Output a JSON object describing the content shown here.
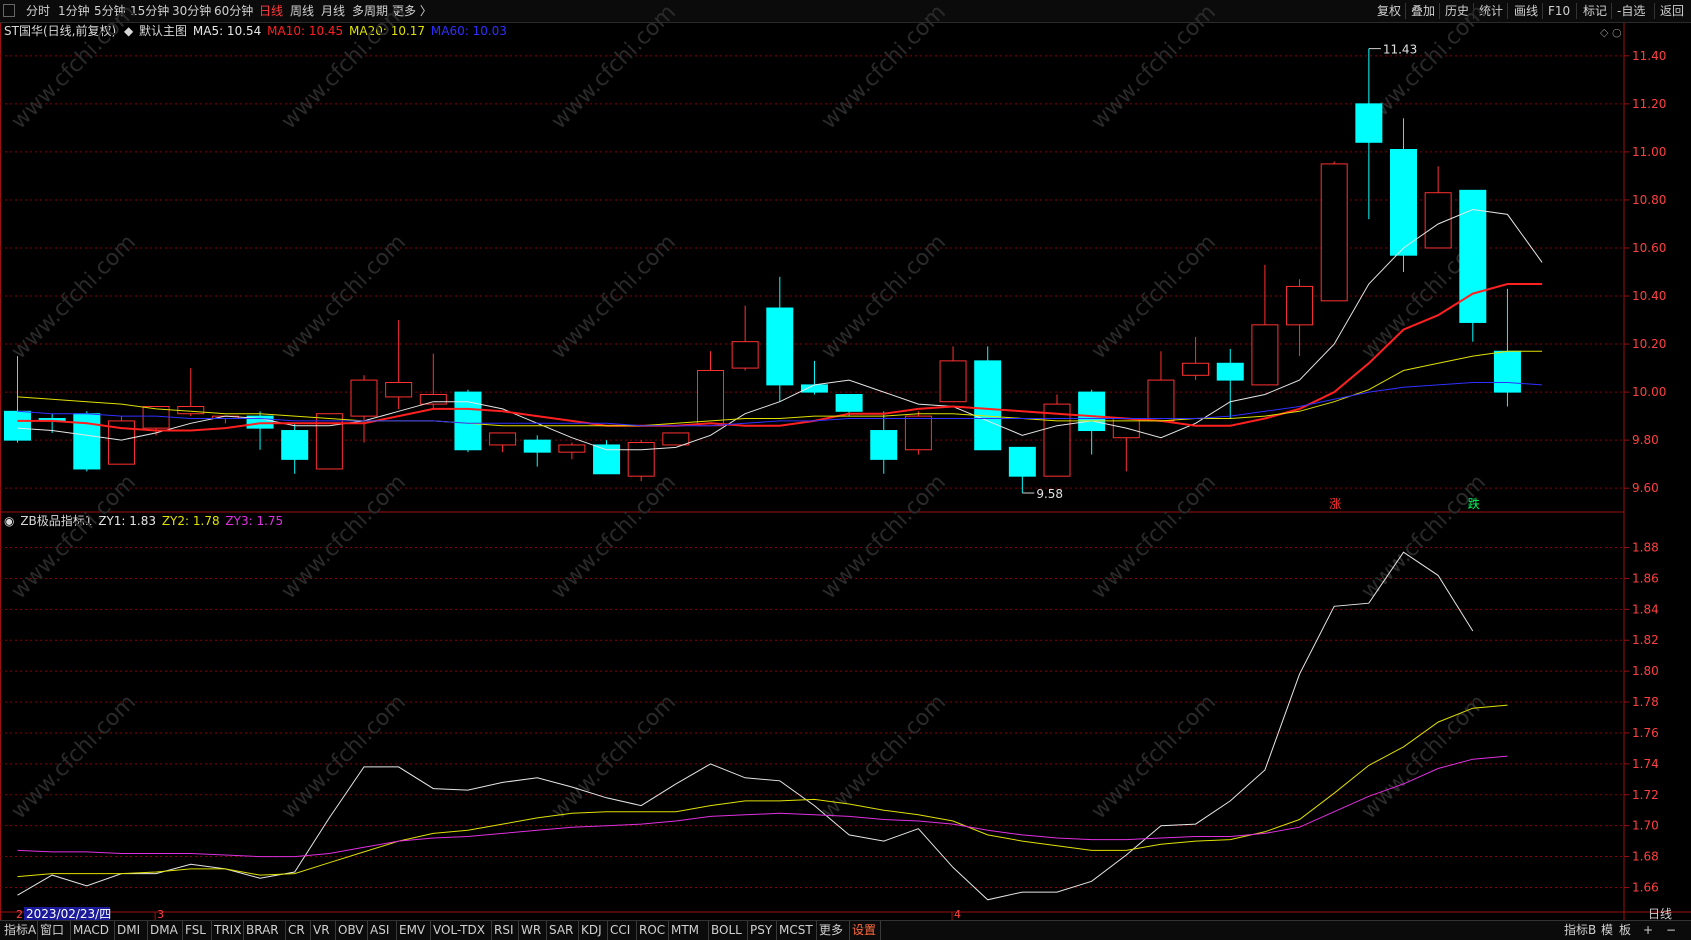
{
  "toolbar": {
    "periods": [
      "分时",
      "1分钟",
      "5分钟",
      "15分钟",
      "30分钟",
      "60分钟",
      "日线",
      "周线",
      "月线",
      "多周期",
      "更多 〉"
    ],
    "active_period": "日线",
    "right_items": [
      "复权",
      "叠加",
      "历史",
      "统计",
      "画线",
      "F10",
      "标记",
      "-自选",
      "返回"
    ]
  },
  "main_chart": {
    "title": "ST国华(日线,前复权)",
    "template": "默认主图",
    "indicators": [
      {
        "label": "MA5: 10.54",
        "color": "#e6e6e6"
      },
      {
        "label": "MA10: 10.45",
        "color": "#ff2020"
      },
      {
        "label": "MA20: 10.17",
        "color": "#e0e000"
      },
      {
        "label": "MA60: 10.03",
        "color": "#3030ff"
      }
    ],
    "high_label": "11.43",
    "low_label": "9.58",
    "up_marker": "涨",
    "down_marker": "跌",
    "ylim": [
      9.53,
      11.47
    ],
    "yticks": [
      "11.40",
      "11.20",
      "11.00",
      "10.80",
      "10.60",
      "10.40",
      "10.20",
      "10.00",
      "9.80",
      "9.60"
    ]
  },
  "sub_chart": {
    "title": "ZB极品指标1",
    "indicators": [
      {
        "label": "ZY1: 1.83",
        "color": "#e6e6e6"
      },
      {
        "label": "ZY2: 1.78",
        "color": "#e0e000"
      },
      {
        "label": "ZY3: 1.75",
        "color": "#e030e0"
      }
    ],
    "ylim": [
      1.648,
      1.892
    ],
    "yticks": [
      "1.88",
      "1.86",
      "1.84",
      "1.82",
      "1.80",
      "1.78",
      "1.76",
      "1.74",
      "1.72",
      "1.70",
      "1.68",
      "1.66"
    ]
  },
  "time_axis": {
    "current_date": "2023/02/23/四",
    "month_markers": [
      {
        "label": "3",
        "index": 4
      },
      {
        "label": "4",
        "index": 27
      }
    ]
  },
  "watermark": "www.cfchi.com",
  "chart_data": {
    "type": "candlestick",
    "candles": [
      {
        "o": 9.92,
        "h": 10.15,
        "l": 9.79,
        "c": 9.8
      },
      {
        "o": 9.89,
        "h": 9.91,
        "l": 9.83,
        "c": 9.88
      },
      {
        "o": 9.91,
        "h": 9.92,
        "l": 9.67,
        "c": 9.68
      },
      {
        "o": 9.7,
        "h": 9.9,
        "l": 9.7,
        "c": 9.88
      },
      {
        "o": 9.85,
        "h": 9.94,
        "l": 9.82,
        "c": 9.94
      },
      {
        "o": 9.91,
        "h": 10.1,
        "l": 9.9,
        "c": 9.94
      },
      {
        "o": 9.89,
        "h": 9.9,
        "l": 9.87,
        "c": 9.9
      },
      {
        "o": 9.9,
        "h": 9.92,
        "l": 9.76,
        "c": 9.85
      },
      {
        "o": 9.84,
        "h": 9.87,
        "l": 9.66,
        "c": 9.72
      },
      {
        "o": 9.68,
        "h": 9.91,
        "l": 9.68,
        "c": 9.91
      },
      {
        "o": 9.9,
        "h": 10.07,
        "l": 9.79,
        "c": 10.05
      },
      {
        "o": 9.98,
        "h": 10.3,
        "l": 9.93,
        "c": 10.04
      },
      {
        "o": 9.95,
        "h": 10.16,
        "l": 9.93,
        "c": 9.99
      },
      {
        "o": 10.0,
        "h": 10.01,
        "l": 9.75,
        "c": 9.76
      },
      {
        "o": 9.78,
        "h": 9.82,
        "l": 9.75,
        "c": 9.83
      },
      {
        "o": 9.8,
        "h": 9.82,
        "l": 9.69,
        "c": 9.75
      },
      {
        "o": 9.75,
        "h": 9.79,
        "l": 9.72,
        "c": 9.78
      },
      {
        "o": 9.78,
        "h": 9.8,
        "l": 9.66,
        "c": 9.66
      },
      {
        "o": 9.65,
        "h": 9.8,
        "l": 9.63,
        "c": 9.79
      },
      {
        "o": 9.78,
        "h": 9.83,
        "l": 9.78,
        "c": 9.83
      },
      {
        "o": 9.86,
        "h": 10.17,
        "l": 9.86,
        "c": 10.09
      },
      {
        "o": 10.1,
        "h": 10.36,
        "l": 10.09,
        "c": 10.21
      },
      {
        "o": 10.35,
        "h": 10.48,
        "l": 9.96,
        "c": 10.03
      },
      {
        "o": 10.03,
        "h": 10.13,
        "l": 9.99,
        "c": 10.0
      },
      {
        "o": 9.99,
        "h": 9.99,
        "l": 9.9,
        "c": 9.92
      },
      {
        "o": 9.84,
        "h": 9.92,
        "l": 9.66,
        "c": 9.72
      },
      {
        "o": 9.76,
        "h": 9.92,
        "l": 9.74,
        "c": 9.9
      },
      {
        "o": 9.96,
        "h": 10.19,
        "l": 9.96,
        "c": 10.13
      },
      {
        "o": 10.13,
        "h": 10.19,
        "l": 9.76,
        "c": 9.76
      },
      {
        "o": 9.77,
        "h": 9.77,
        "l": 9.58,
        "c": 9.65
      },
      {
        "o": 9.65,
        "h": 9.99,
        "l": 9.65,
        "c": 9.95
      },
      {
        "o": 10.0,
        "h": 10.01,
        "l": 9.74,
        "c": 9.84
      },
      {
        "o": 9.81,
        "h": 9.89,
        "l": 9.67,
        "c": 9.89
      },
      {
        "o": 9.88,
        "h": 10.17,
        "l": 9.88,
        "c": 10.05
      },
      {
        "o": 10.07,
        "h": 10.23,
        "l": 10.05,
        "c": 10.12
      },
      {
        "o": 10.12,
        "h": 10.18,
        "l": 9.89,
        "c": 10.05
      },
      {
        "o": 10.03,
        "h": 10.53,
        "l": 10.03,
        "c": 10.28
      },
      {
        "o": 10.28,
        "h": 10.47,
        "l": 10.15,
        "c": 10.44
      },
      {
        "o": 10.38,
        "h": 10.96,
        "l": 10.38,
        "c": 10.95
      },
      {
        "o": 11.2,
        "h": 11.43,
        "l": 10.72,
        "c": 11.04
      },
      {
        "o": 11.01,
        "h": 11.14,
        "l": 10.5,
        "c": 10.57
      },
      {
        "o": 10.6,
        "h": 10.94,
        "l": 10.6,
        "c": 10.83
      },
      {
        "o": 10.84,
        "h": 10.84,
        "l": 10.21,
        "c": 10.29
      },
      {
        "o": 10.17,
        "h": 10.43,
        "l": 9.94,
        "c": 10.0
      }
    ],
    "series": [
      {
        "name": "MA5",
        "values": [
          9.85,
          9.84,
          9.82,
          9.8,
          9.83,
          9.87,
          9.9,
          9.89,
          9.86,
          9.86,
          9.88,
          9.92,
          9.96,
          9.96,
          9.93,
          9.87,
          9.81,
          9.76,
          9.76,
          9.77,
          9.82,
          9.91,
          9.96,
          10.03,
          10.05,
          10.0,
          9.95,
          9.94,
          9.88,
          9.82,
          9.86,
          9.88,
          9.85,
          9.81,
          9.87,
          9.96,
          9.99,
          10.05,
          10.2,
          10.45,
          10.6,
          10.7,
          10.76,
          10.74,
          10.54
        ]
      },
      {
        "name": "MA10",
        "values": [
          9.88,
          9.88,
          9.87,
          9.85,
          9.84,
          9.84,
          9.85,
          9.87,
          9.87,
          9.87,
          9.87,
          9.9,
          9.93,
          9.93,
          9.92,
          9.9,
          9.88,
          9.86,
          9.86,
          9.86,
          9.87,
          9.86,
          9.86,
          9.88,
          9.91,
          9.91,
          9.93,
          9.94,
          9.93,
          9.92,
          9.91,
          9.9,
          9.89,
          9.88,
          9.86,
          9.86,
          9.89,
          9.93,
          10.0,
          10.12,
          10.26,
          10.32,
          10.41,
          10.45,
          10.45
        ]
      },
      {
        "name": "MA20",
        "values": [
          9.98,
          9.97,
          9.96,
          9.95,
          9.93,
          9.92,
          9.91,
          9.91,
          9.9,
          9.89,
          9.88,
          9.88,
          9.88,
          9.87,
          9.86,
          9.86,
          9.86,
          9.86,
          9.86,
          9.87,
          9.88,
          9.89,
          9.89,
          9.9,
          9.9,
          9.9,
          9.91,
          9.91,
          9.9,
          9.89,
          9.88,
          9.88,
          9.88,
          9.88,
          9.89,
          9.89,
          9.9,
          9.92,
          9.96,
          10.01,
          10.09,
          10.12,
          10.15,
          10.17,
          10.17
        ]
      },
      {
        "name": "MA60",
        "values": [
          9.92,
          9.91,
          9.91,
          9.9,
          9.9,
          9.89,
          9.89,
          9.89,
          9.88,
          9.88,
          9.88,
          9.88,
          9.88,
          9.87,
          9.87,
          9.87,
          9.87,
          9.87,
          9.86,
          9.86,
          9.86,
          9.87,
          9.88,
          9.88,
          9.89,
          9.89,
          9.89,
          9.89,
          9.89,
          9.89,
          9.89,
          9.89,
          9.89,
          9.89,
          9.89,
          9.9,
          9.92,
          9.94,
          9.97,
          10.0,
          10.02,
          10.03,
          10.04,
          10.04,
          10.03
        ]
      },
      {
        "name": "ZY1",
        "values": [
          1.655,
          1.668,
          1.661,
          1.669,
          1.669,
          1.675,
          1.672,
          1.666,
          1.67,
          1.705,
          1.738,
          1.738,
          1.724,
          1.723,
          1.728,
          1.731,
          1.725,
          1.718,
          1.713,
          1.727,
          1.74,
          1.731,
          1.729,
          1.713,
          1.694,
          1.69,
          1.698,
          1.673,
          1.652,
          1.657,
          1.657,
          1.664,
          1.681,
          1.7,
          1.701,
          1.716,
          1.736,
          1.798,
          1.842,
          1.844,
          1.877,
          1.862,
          1.826
        ]
      },
      {
        "name": "ZY2",
        "values": [
          1.667,
          1.669,
          1.669,
          1.669,
          1.67,
          1.672,
          1.672,
          1.668,
          1.669,
          1.676,
          1.683,
          1.69,
          1.695,
          1.697,
          1.701,
          1.705,
          1.708,
          1.709,
          1.709,
          1.709,
          1.713,
          1.716,
          1.716,
          1.717,
          1.714,
          1.71,
          1.707,
          1.703,
          1.694,
          1.69,
          1.687,
          1.684,
          1.684,
          1.688,
          1.69,
          1.691,
          1.696,
          1.704,
          1.721,
          1.739,
          1.751,
          1.767,
          1.776,
          1.778
        ]
      },
      {
        "name": "ZY3",
        "values": [
          1.684,
          1.683,
          1.683,
          1.682,
          1.682,
          1.682,
          1.681,
          1.68,
          1.68,
          1.682,
          1.686,
          1.69,
          1.692,
          1.693,
          1.695,
          1.697,
          1.699,
          1.7,
          1.701,
          1.703,
          1.706,
          1.707,
          1.708,
          1.707,
          1.706,
          1.704,
          1.703,
          1.701,
          1.697,
          1.694,
          1.692,
          1.691,
          1.691,
          1.692,
          1.693,
          1.693,
          1.695,
          1.699,
          1.709,
          1.719,
          1.727,
          1.737,
          1.743,
          1.745
        ]
      }
    ]
  },
  "bottom_tabs": [
    "指标A",
    "窗口",
    "MACD",
    "DMI",
    "DMA",
    "FSL",
    "TRIX",
    "BRAR",
    "CR",
    "VR",
    "OBV",
    "ASI",
    "EMV",
    "VOL-TDX",
    "RSI",
    "WR",
    "SAR",
    "KDJ",
    "CCI",
    "ROC",
    "MTM",
    "BOLL",
    "PSY",
    "MCST",
    "更多",
    "设置"
  ],
  "bottom_right": [
    "指标B",
    "模",
    "板",
    "+",
    "−"
  ],
  "right_corner": "日线",
  "colors": {
    "up": "#ff3030",
    "down": "#00ffff",
    "grid": "#8b0000",
    "axis_text": "#ff4040",
    "background": "#000000"
  }
}
